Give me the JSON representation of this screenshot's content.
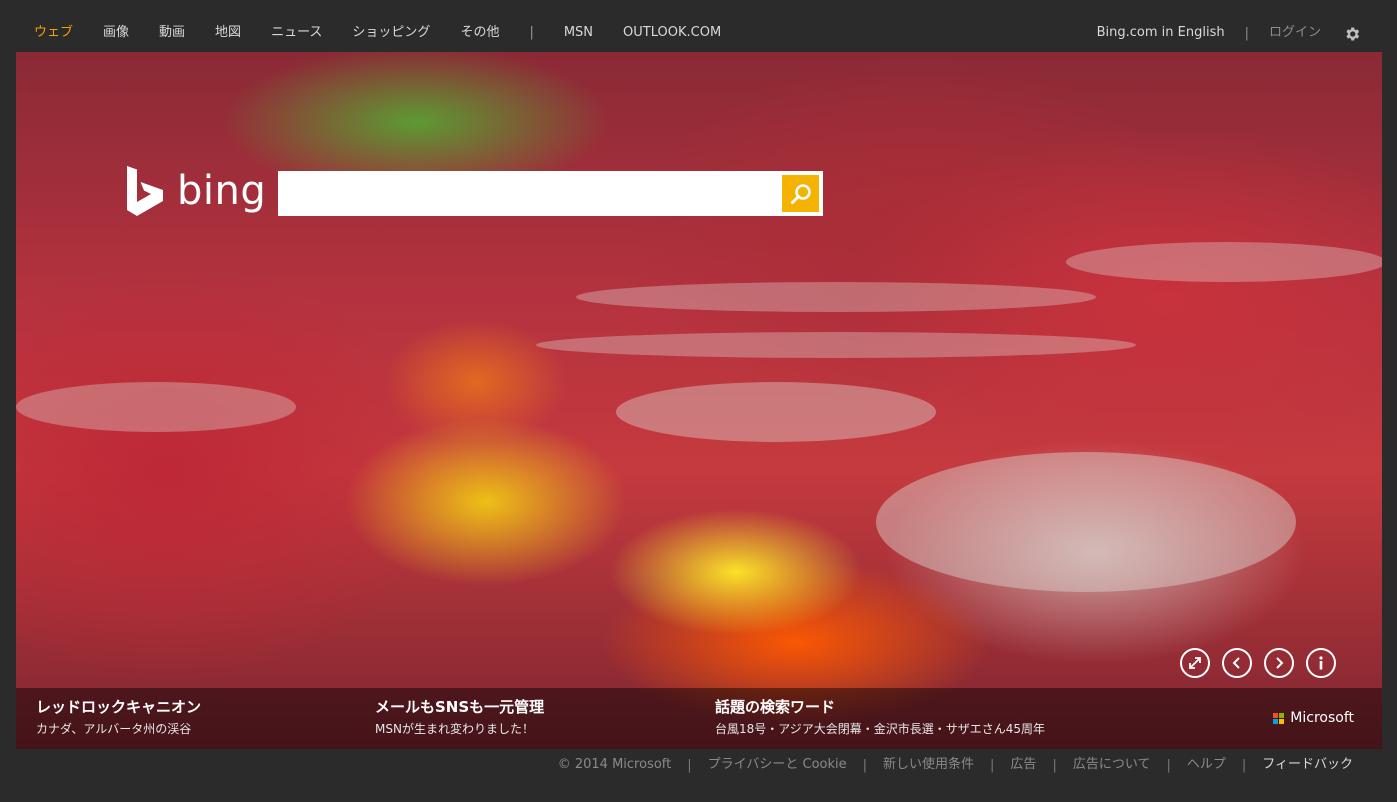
{
  "nav": {
    "items": [
      {
        "label": "ウェブ",
        "active": true
      },
      {
        "label": "画像"
      },
      {
        "label": "動画"
      },
      {
        "label": "地図"
      },
      {
        "label": "ニュース"
      },
      {
        "label": "ショッピング"
      },
      {
        "label": "その他"
      }
    ],
    "separator": "|",
    "external": [
      "MSN",
      "OUTLOOK.COM"
    ],
    "right": {
      "english": "Bing.com in English",
      "separator": "|",
      "login": "ログイン",
      "settings_icon": "gear-icon"
    }
  },
  "logo": {
    "text": "bing",
    "icon": "bing-b-icon"
  },
  "search": {
    "value": "",
    "placeholder": "",
    "button_icon": "search-icon",
    "accent": "#f3b300"
  },
  "controls": [
    "fullscreen-icon",
    "prev-icon",
    "next-icon",
    "info-icon"
  ],
  "info": [
    {
      "title": "レッドロックキャニオン",
      "sub": "カナダ、アルバータ州の渓谷"
    },
    {
      "title": "メールもSNSも一元管理",
      "sub": "MSNが生まれ変わりました！"
    },
    {
      "title": "話題の検索ワード",
      "sub": "台風18号・アジア大会閉幕・金沢市長選・サザエさん45周年"
    }
  ],
  "brand": {
    "name": "Microsoft",
    "colors": [
      "#f25022",
      "#7fba00",
      "#00a4ef",
      "#ffb900"
    ]
  },
  "footer": {
    "items": [
      "© 2014 Microsoft",
      "プライバシーと Cookie",
      "新しい使用条件",
      "広告",
      "広告について",
      "ヘルプ",
      "フィードバック"
    ],
    "separator": "|"
  },
  "colors": {
    "active_nav": "#f3a200",
    "background": "#2b2b2b"
  }
}
